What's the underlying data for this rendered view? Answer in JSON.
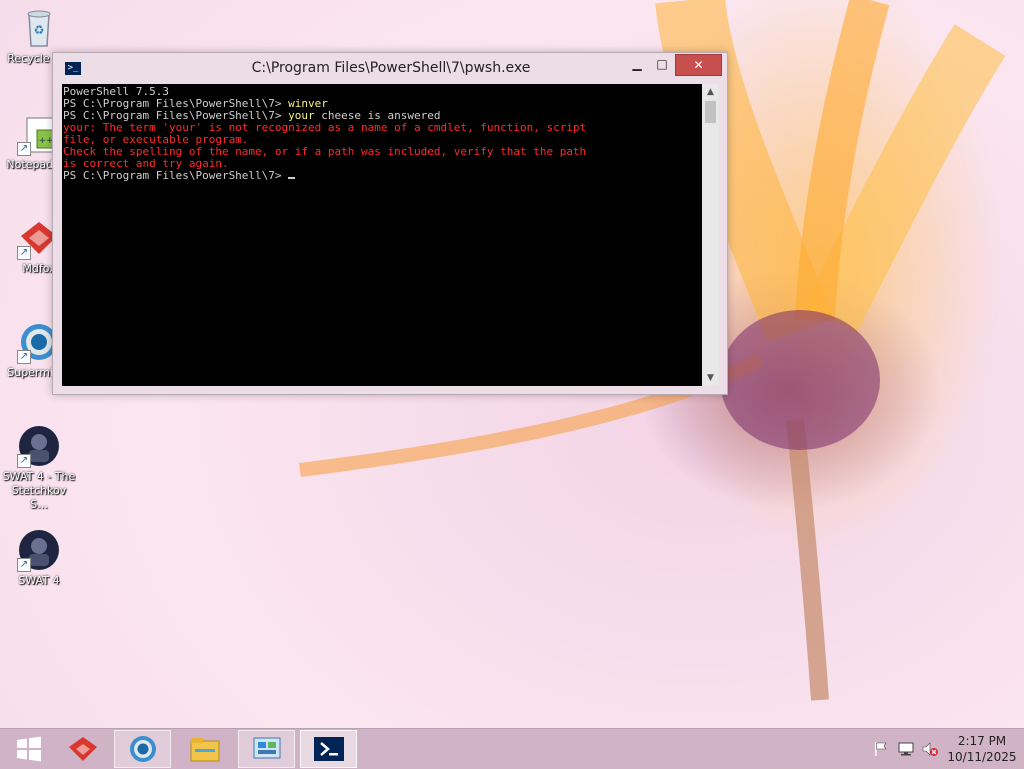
{
  "desktop": {
    "icons": [
      {
        "label": "Recycle Bin",
        "icon": "recycle-bin-icon"
      },
      {
        "label": "Notepad++",
        "icon": "notepad-plus-plus-icon"
      },
      {
        "label": "Mdfox",
        "icon": "mdfox-icon"
      },
      {
        "label": "Supermium",
        "icon": "supermium-icon"
      },
      {
        "label": "SWAT 4 - The Stetchkov S...",
        "icon": "swat4-expansion-icon"
      },
      {
        "label": "SWAT 4",
        "icon": "swat4-icon"
      }
    ]
  },
  "window": {
    "title": "C:\\Program Files\\PowerShell\\7\\pwsh.exe",
    "min_label": "▁",
    "max_label": "□",
    "close_label": "✕"
  },
  "console": {
    "banner": "PowerShell 7.5.3",
    "prompt": "PS C:\\Program Files\\PowerShell\\7> ",
    "cmd1": "winver",
    "cmd2_word": "your",
    "cmd2_rest": " cheese is answered",
    "error_lines": [
      "your: The term 'your' is not recognized as a name of a cmdlet, function, script",
      "file, or executable program.",
      "Check the spelling of the name, or if a path was included, verify that the path",
      "is correct and try again."
    ]
  },
  "taskbar": {
    "items": [
      "start-button",
      "mdfox-taskbar",
      "supermium-taskbar",
      "file-explorer-taskbar",
      "control-panel-taskbar",
      "powershell-taskbar"
    ],
    "time": "2:17 PM",
    "date": "10/11/2025"
  }
}
